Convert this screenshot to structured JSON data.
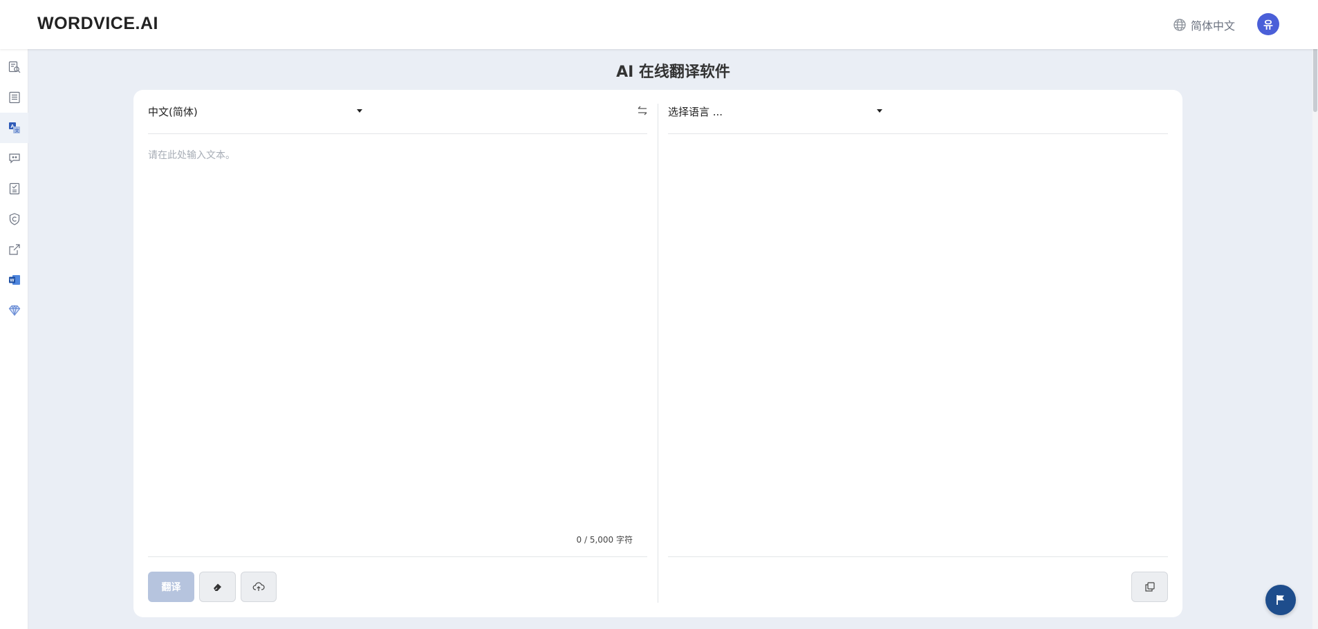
{
  "header": {
    "logo": "WORDVICE.AI",
    "language": "简体中文",
    "avatar_initial": "유"
  },
  "sidebar": {
    "items": [
      {
        "name": "search-doc",
        "active": false
      },
      {
        "name": "document-list",
        "active": false
      },
      {
        "name": "translate",
        "active": true
      },
      {
        "name": "chat-feedback",
        "active": false
      },
      {
        "name": "checklist",
        "active": false
      },
      {
        "name": "plagiarism-shield",
        "active": false
      },
      {
        "name": "external-link",
        "active": false
      },
      {
        "name": "word-addin",
        "active": false
      },
      {
        "name": "premium-diamond",
        "active": false
      }
    ]
  },
  "page": {
    "title": "AI 在线翻译软件"
  },
  "translator": {
    "source_language": "中文(简体)",
    "target_language": "选择语言 ...",
    "input_placeholder": "请在此处输入文本。",
    "char_count": "0 / 5,000 字符",
    "translate_label": "翻译"
  },
  "colors": {
    "accent": "#4a5fd8",
    "translate_disabled": "#b6c4de",
    "fab": "#1e4d8c",
    "background": "#eaeef5"
  }
}
